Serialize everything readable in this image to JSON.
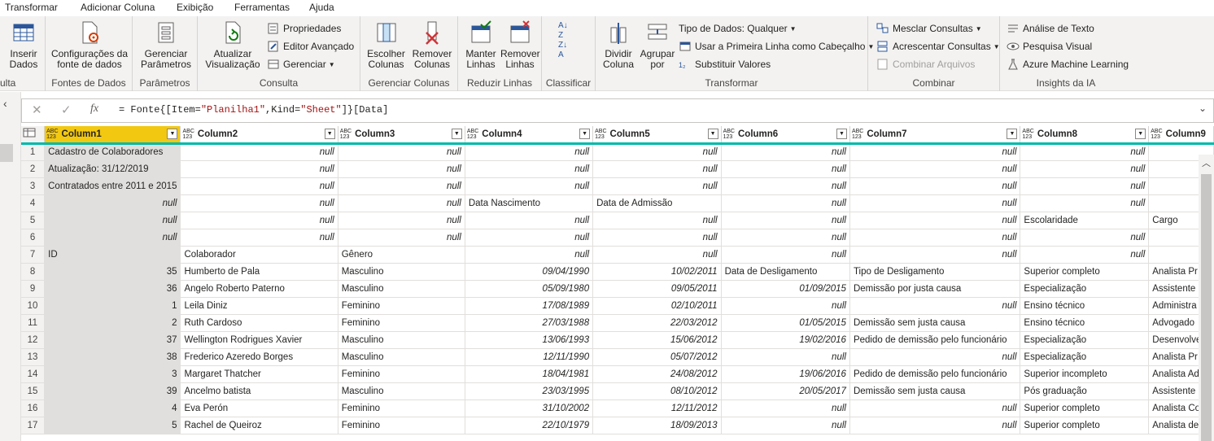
{
  "tabs": [
    "Transformar",
    "Adicionar Coluna",
    "Exibição",
    "Ferramentas",
    "Ajuda"
  ],
  "ribbon": {
    "g0": {
      "label": "ulta",
      "btn": "Inserir\nDados"
    },
    "g1": {
      "label": "Fontes de Dados",
      "btn": "Configurações da\nfonte de dados"
    },
    "g2": {
      "label": "Parâmetros",
      "btn": "Gerenciar\nParâmetros"
    },
    "g3": {
      "label": "Consulta",
      "btn": "Atualizar\nVisualização",
      "s1": "Propriedades",
      "s2": "Editor Avançado",
      "s3": "Gerenciar"
    },
    "g4": {
      "label": "Gerenciar Colunas",
      "b1": "Escolher\nColunas",
      "b2": "Remover\nColunas"
    },
    "g5": {
      "label": "Reduzir Linhas",
      "b1": "Manter\nLinhas",
      "b2": "Remover\nLinhas"
    },
    "g6": {
      "label": "Classificar"
    },
    "g7": {
      "label": "Transformar",
      "b1": "Dividir\nColuna",
      "b2": "Agrupar\npor",
      "s1": "Tipo de Dados: Qualquer",
      "s2": "Usar a Primeira Linha como Cabeçalho",
      "s3": "Substituir Valores"
    },
    "g8": {
      "label": "Combinar",
      "s1": "Mesclar Consultas",
      "s2": "Acrescentar Consultas",
      "s3": "Combinar Arquivos"
    },
    "g9": {
      "label": "Insights da IA",
      "s1": "Análise de Texto",
      "s2": "Pesquisa Visual",
      "s3": "Azure Machine Learning"
    }
  },
  "formula": "= Fonte{[Item=\"Planilha1\",Kind=\"Sheet\"]}[Data]",
  "fx": "fx",
  "type_label": "ABC\n123",
  "columns": [
    "Column1",
    "Column2",
    "Column3",
    "Column4",
    "Column5",
    "Column6",
    "Column7",
    "Column8",
    "Column9"
  ],
  "rows": [
    [
      "1",
      "Cadastro de Colaboradores",
      "null",
      "null",
      "null",
      "null",
      "null",
      "null",
      "null",
      ""
    ],
    [
      "2",
      "Atualização: 31/12/2019",
      "null",
      "null",
      "null",
      "null",
      "null",
      "null",
      "null",
      ""
    ],
    [
      "3",
      "Contratados entre 2011 e 2015",
      "null",
      "null",
      "null",
      "null",
      "null",
      "null",
      "null",
      ""
    ],
    [
      "4",
      "null",
      "null",
      "null",
      "Data Nascimento",
      "Data de Admissão",
      "null",
      "null",
      "null",
      ""
    ],
    [
      "5",
      "null",
      "null",
      "null",
      "null",
      "null",
      "null",
      "null",
      "Escolaridade",
      "Cargo"
    ],
    [
      "6",
      "null",
      "null",
      "null",
      "null",
      "null",
      "null",
      "null",
      "null",
      ""
    ],
    [
      "7",
      "ID",
      "Colaborador",
      "Gênero",
      "null",
      "null",
      "null",
      "null",
      "null",
      ""
    ],
    [
      "8",
      "35",
      "Humberto de Pala",
      "Masculino",
      "09/04/1990",
      "10/02/2011",
      "Data de Desligamento",
      "Tipo de Desligamento",
      "Superior completo",
      "Analista Pr"
    ],
    [
      "9",
      "36",
      "Angelo Roberto Paterno",
      "Masculino",
      "05/09/1980",
      "09/05/2011",
      "01/09/2015",
      "Demissão por justa causa",
      "Especialização",
      "Assistente"
    ],
    [
      "10",
      "1",
      "Leila Diniz",
      "Feminino",
      "17/08/1989",
      "02/10/2011",
      "null",
      "null",
      "Ensino técnico",
      "Administra"
    ],
    [
      "11",
      "2",
      "Ruth Cardoso",
      "Feminino",
      "27/03/1988",
      "22/03/2012",
      "01/05/2015",
      "Demissão sem justa causa",
      "Ensino técnico",
      "Advogado"
    ],
    [
      "12",
      "37",
      "Wellington Rodrigues Xavier",
      "Masculino",
      "13/06/1993",
      "15/06/2012",
      "19/02/2016",
      "Pedido de demissão pelo funcionário",
      "Especialização",
      "Desenvolve"
    ],
    [
      "13",
      "38",
      "Frederico Azeredo Borges",
      "Masculino",
      "12/11/1990",
      "05/07/2012",
      "null",
      "null",
      "Especialização",
      "Analista Pr"
    ],
    [
      "14",
      "3",
      "Margaret Thatcher",
      "Feminino",
      "18/04/1981",
      "24/08/2012",
      "19/06/2016",
      "Pedido de demissão pelo funcionário",
      "Superior incompleto",
      "Analista Ad"
    ],
    [
      "15",
      "39",
      "Ancelmo batista",
      "Masculino",
      "23/03/1995",
      "08/10/2012",
      "20/05/2017",
      "Demissão sem justa causa",
      "Pós graduação",
      "Assistente"
    ],
    [
      "16",
      "4",
      "Eva Perón",
      "Feminino",
      "31/10/2002",
      "12/11/2012",
      "null",
      "null",
      "Superior completo",
      "Analista Co"
    ],
    [
      "17",
      "5",
      "Rachel de Queiroz",
      "Feminino",
      "22/10/1979",
      "18/09/2013",
      "null",
      "null",
      "Superior completo",
      "Analista de"
    ]
  ],
  "colors": {
    "selected_header": "#f2c811",
    "quality_bar": "#01b8aa",
    "ribbon_bg": "#f3f2f1"
  }
}
